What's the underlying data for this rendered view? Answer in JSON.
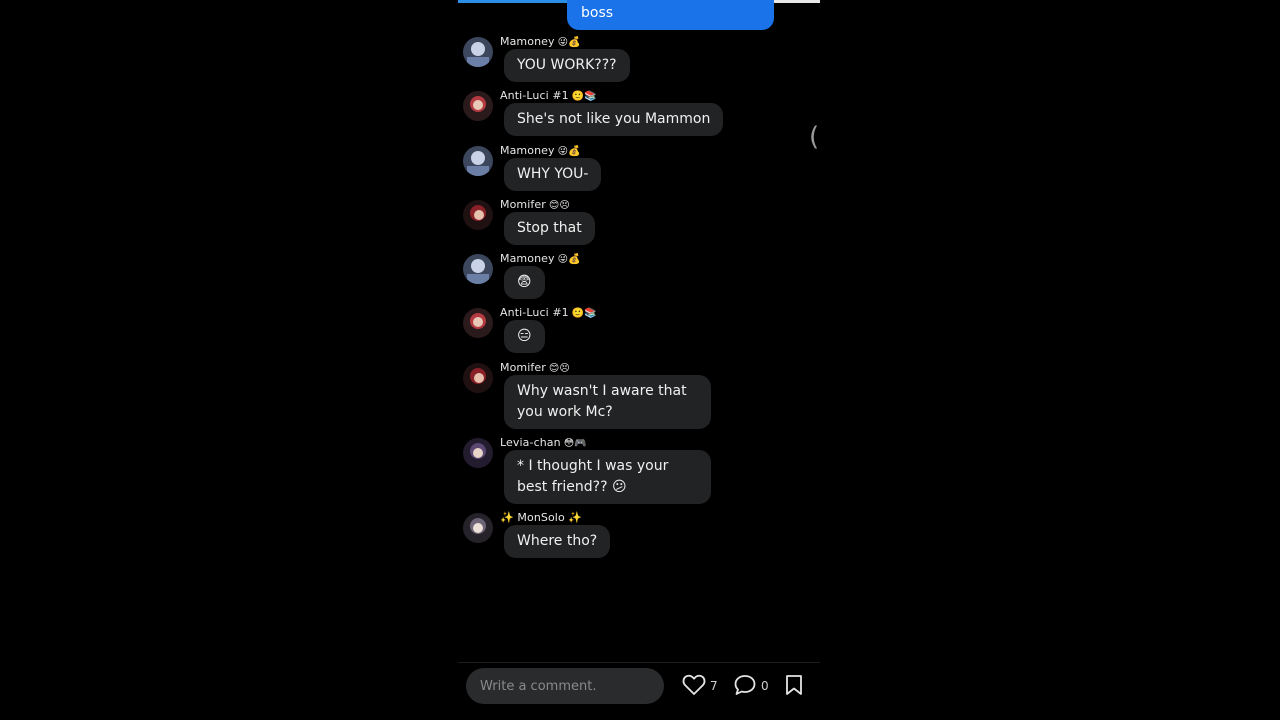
{
  "sent_message": {
    "text": "boss"
  },
  "messages": [
    {
      "sender": "Mamoney",
      "sender_emoji": "😜💰",
      "text": "YOU WORK???",
      "avatar_color": "#5a6b8c"
    },
    {
      "sender": "Anti-Luci #1",
      "sender_emoji": "🙂📚",
      "text": "She's not like you Mammon",
      "avatar_color": "#a3333b"
    },
    {
      "sender": "Mamoney",
      "sender_emoji": "😜💰",
      "text": "WHY YOU-",
      "avatar_color": "#5a6b8c"
    },
    {
      "sender": "Momifer",
      "sender_emoji": "😊😣",
      "text": "Stop that",
      "avatar_color": "#7a1f24"
    },
    {
      "sender": "Mamoney",
      "sender_emoji": "😜💰",
      "text": "😨",
      "avatar_color": "#5a6b8c"
    },
    {
      "sender": "Anti-Luci #1",
      "sender_emoji": "🙂📚",
      "text": "😑",
      "avatar_color": "#a3333b"
    },
    {
      "sender": "Momifer",
      "sender_emoji": "😊😣",
      "text": "Why wasn't I aware that you work Mc?",
      "avatar_color": "#7a1f24"
    },
    {
      "sender": "Levia-chan",
      "sender_emoji": "😳🎮",
      "text": "* I thought I was your best friend?? 😕",
      "avatar_color": "#4a3a5a"
    },
    {
      "sender": "✨ MonSolo ✨",
      "sender_emoji": "",
      "text": "Where tho?",
      "avatar_color": "#5b5260"
    }
  ],
  "comment": {
    "placeholder": "Write a comment."
  },
  "actions": {
    "likes": "7",
    "comments": "0"
  },
  "side_glyph": "("
}
